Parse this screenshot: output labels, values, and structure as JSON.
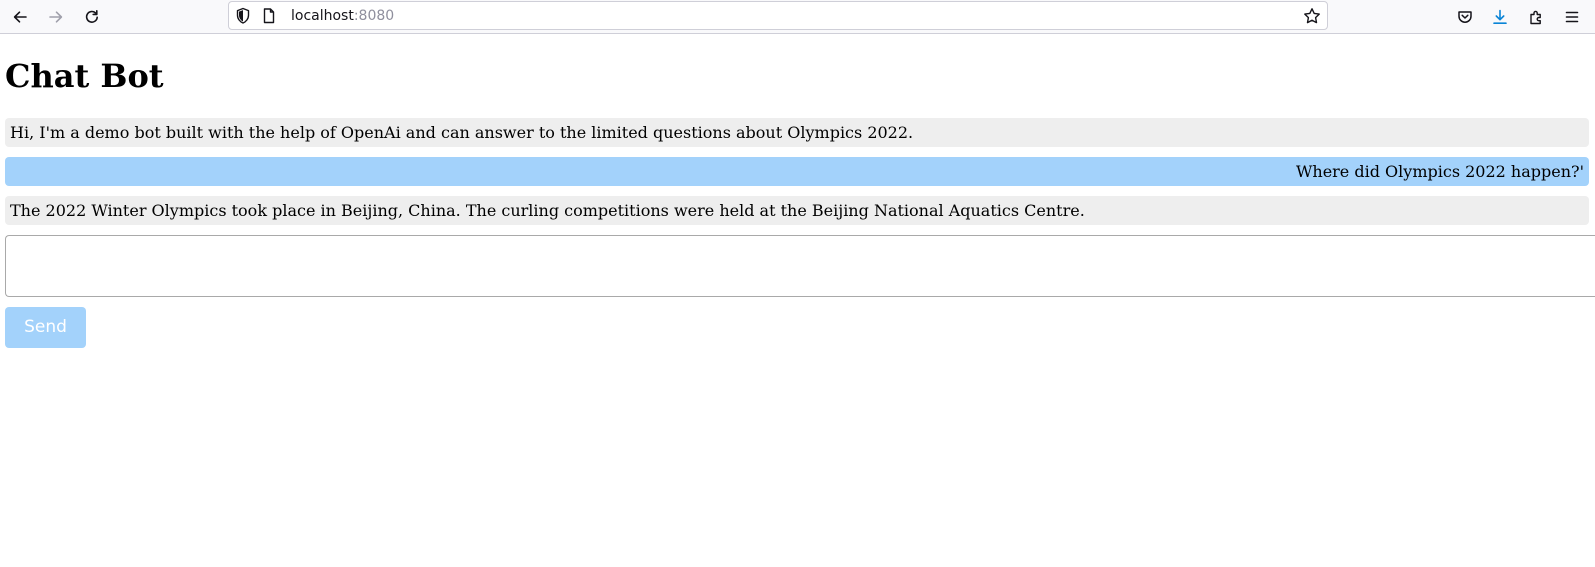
{
  "browser": {
    "url_host": "localhost",
    "url_port": ":8080",
    "icons": {
      "back": "arrow-left-icon",
      "forward": "arrow-right-icon",
      "reload": "reload-icon",
      "shield": "shield-icon",
      "page": "page-icon",
      "bookmark": "star-icon",
      "pocket": "pocket-icon",
      "downloads": "download-icon",
      "extensions": "extensions-icon",
      "menu": "hamburger-menu-icon"
    }
  },
  "page": {
    "title": "Chat Bot"
  },
  "messages": [
    {
      "role": "bot",
      "text": "Hi, I'm a demo bot built with the help of OpenAi and can answer to the limited questions about Olympics 2022."
    },
    {
      "role": "user",
      "text": "Where did Olympics 2022 happen?'"
    },
    {
      "role": "bot",
      "text": "The 2022 Winter Olympics took place in Beijing, China. The curling competitions were held at the Beijing National Aquatics Centre."
    }
  ],
  "input": {
    "value": "",
    "placeholder": ""
  },
  "send_button": {
    "label": "Send"
  },
  "colors": {
    "bot_bubble": "#eeeeee",
    "user_bubble": "#a3d2fb",
    "send_button": "#a3d2fb",
    "download_accent": "#0a84d6"
  }
}
